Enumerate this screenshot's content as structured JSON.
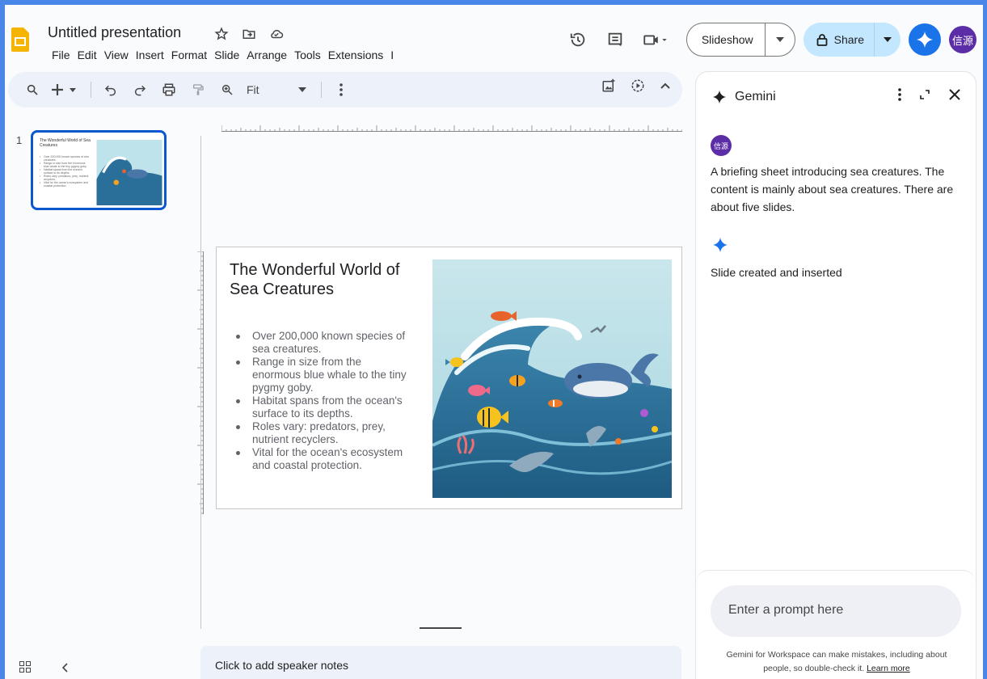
{
  "app": {
    "doc_title": "Untitled presentation",
    "menu": [
      "File",
      "Edit",
      "View",
      "Insert",
      "Format",
      "Slide",
      "Arrange",
      "Tools",
      "Extensions",
      "I"
    ]
  },
  "header": {
    "slideshow_label": "Slideshow",
    "share_label": "Share",
    "avatar_text": "信源"
  },
  "toolbar": {
    "zoom_label": "Fit"
  },
  "filmstrip": {
    "slide_number": "1",
    "thumb_title": "The Wonderful World of Sea Creatures"
  },
  "slide": {
    "title": "The Wonderful World of Sea Creatures",
    "bullets": [
      "Over 200,000 known species of sea creatures.",
      "Range in size from the enormous blue whale to the tiny pygmy goby.",
      "Habitat spans from the ocean's surface to its depths.",
      "Roles vary: predators, prey, nutrient recyclers.",
      "Vital for the ocean's ecosystem and coastal protection."
    ]
  },
  "notes": {
    "placeholder": "Click to add speaker notes"
  },
  "gemini": {
    "title": "Gemini",
    "user_avatar": "信源",
    "user_message": "A briefing sheet introducing sea creatures. The content is mainly about sea creatures. There are about five slides.",
    "reply": "Slide created and inserted",
    "prompt_placeholder": "Enter a prompt here",
    "disclaimer": "Gemini for Workspace can make mistakes, including about people, so double-check it.",
    "learn_more": "Learn more"
  },
  "colors": {
    "accent": "#0b57d0",
    "share_bg": "#c2e7ff",
    "gemini_blue": "#1a73e8",
    "avatar": "#5b2da6",
    "logo": "#f4b400"
  }
}
